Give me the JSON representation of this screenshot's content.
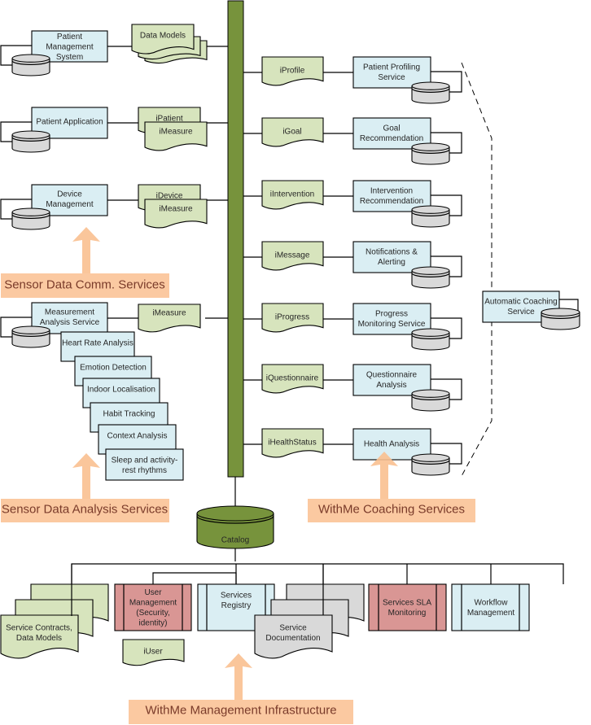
{
  "left_services": [
    {
      "label": [
        "Patient",
        "Management",
        "System"
      ],
      "docs": [
        [
          "Data Models"
        ]
      ],
      "doc_style": "stack3"
    },
    {
      "label": [
        "Patient Application"
      ],
      "docs": [
        [
          "iPatient"
        ],
        [
          "iMeasure"
        ]
      ],
      "doc_style": "pair"
    },
    {
      "label": [
        "Device",
        "Management"
      ],
      "docs": [
        [
          "iDevice"
        ],
        [
          "iMeasure"
        ]
      ],
      "doc_style": "pair"
    },
    {
      "label": [
        "Measurement",
        "Analysis Service"
      ],
      "docs": [
        [
          "iMeasure"
        ]
      ],
      "doc_style": "single"
    }
  ],
  "analysis_submodules": [
    [
      "Heart Rate Analysis"
    ],
    [
      "Emotion Detection"
    ],
    [
      "Indoor Localisation"
    ],
    [
      "Habit Tracking"
    ],
    [
      "Context Analysis"
    ],
    [
      "Sleep and activity-",
      "rest rhythms"
    ]
  ],
  "right_services": [
    {
      "interface": "iProfile",
      "label": [
        "Patient Profiling",
        "Service"
      ]
    },
    {
      "interface": "iGoal",
      "label": [
        "Goal",
        "Recommendation"
      ]
    },
    {
      "interface": "iIntervention",
      "label": [
        "Intervention",
        "Recommendation"
      ]
    },
    {
      "interface": "iMessage",
      "label": [
        "Notifications &",
        "Alerting"
      ]
    },
    {
      "interface": "iProgress",
      "label": [
        "Progress",
        "Monitoring Service"
      ]
    },
    {
      "interface": "iQuestionnaire",
      "label": [
        "Questionnaire",
        "Analysis"
      ]
    },
    {
      "interface": "iHealthStatus",
      "label": [
        "Health Analysis"
      ]
    }
  ],
  "automatic_coaching": [
    "Automatic Coaching",
    "Service"
  ],
  "catalog": "Catalog",
  "management": {
    "contracts": [
      "Service Contracts,",
      "Data Models"
    ],
    "user_management": [
      "User",
      "Management",
      "(Security,",
      "identity)"
    ],
    "iuser": "iUser",
    "registry": [
      "Services",
      "Registry"
    ],
    "documentation": [
      "Service",
      "Documentation"
    ],
    "sla": [
      "Services SLA",
      "Monitoring"
    ],
    "workflow": [
      "Workflow",
      "Management"
    ]
  },
  "banners": {
    "comm": "Sensor Data Comm. Services",
    "analysis": "Sensor Data Analysis Services",
    "coaching": "WithMe Coaching Services",
    "infrastructure": "WithMe Management Infrastructure"
  },
  "colors": {
    "bus": "#77933c",
    "service": "#daeef3",
    "interface_doc": "#d7e4bd",
    "database": "#d9d9d9",
    "security": "#d99694",
    "banner": "#fac090"
  }
}
